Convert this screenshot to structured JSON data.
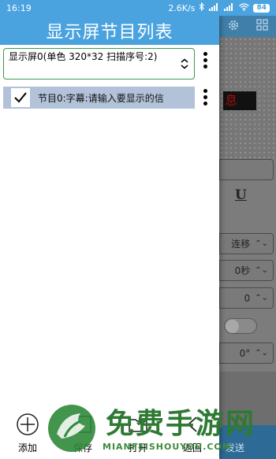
{
  "status_bar": {
    "time": "16:19",
    "network_speed": "2.6K/s",
    "battery": "84"
  },
  "background": {
    "led_text": "息",
    "field_values": [
      "",
      "连移",
      "0秒",
      "0",
      "",
      "0°"
    ],
    "underline_label": "U"
  },
  "drawer": {
    "title": "显示屏节目列表",
    "screen_select_text": "显示屏0(单色 320*32 扫描序号:2)",
    "program_item": "节目0:字幕:请输入要显示的信"
  },
  "toolbar": {
    "add_label": "添加",
    "save_label": "保存",
    "open_label": "打开",
    "back_label": "返回",
    "send_label": "发送"
  },
  "watermark": {
    "title": "免费手游网",
    "subtitle": "MIANFEISHOUYOU.COM"
  },
  "colors": {
    "header": "#4aa3df",
    "accent_green": "#3a9a4a",
    "program_selected": "#b2c2d8",
    "dimmed_background": "#6e6e6e"
  }
}
